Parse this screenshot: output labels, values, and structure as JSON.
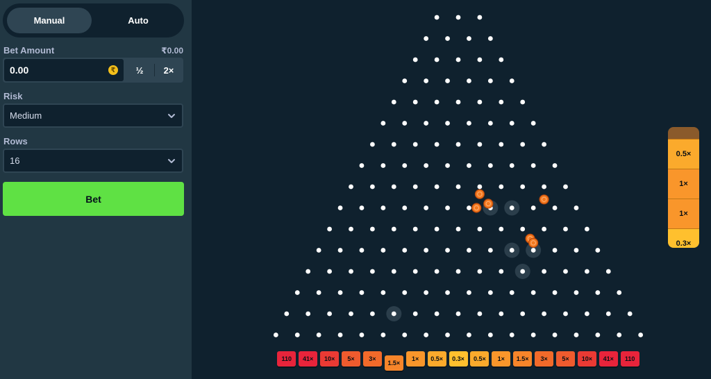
{
  "mode": {
    "manual_label": "Manual",
    "auto_label": "Auto",
    "active": "manual"
  },
  "bet": {
    "label": "Bet Amount",
    "balance": "₹0.00",
    "value": "0.00",
    "currency_symbol": "₹",
    "half_label": "½",
    "double_label": "2×"
  },
  "risk": {
    "label": "Risk",
    "value": "Medium"
  },
  "rows": {
    "label": "Rows",
    "value": "16"
  },
  "bet_button": {
    "label": "Bet"
  },
  "board": {
    "rows": 16,
    "slots": [
      {
        "label": "110",
        "color": "#e8243b"
      },
      {
        "label": "41×",
        "color": "#e8243b"
      },
      {
        "label": "10×",
        "color": "#ea3a34"
      },
      {
        "label": "5×",
        "color": "#ef5b2e"
      },
      {
        "label": "3×",
        "color": "#f26a2a"
      },
      {
        "label": "1.5×",
        "color": "#f7852a",
        "active": true
      },
      {
        "label": "1×",
        "color": "#f9962b"
      },
      {
        "label": "0.5×",
        "color": "#fbaa2c"
      },
      {
        "label": "0.3×",
        "color": "#ffc02e"
      },
      {
        "label": "0.5×",
        "color": "#fbaa2c"
      },
      {
        "label": "1×",
        "color": "#f9962b"
      },
      {
        "label": "1.5×",
        "color": "#f7852a"
      },
      {
        "label": "3×",
        "color": "#f26a2a"
      },
      {
        "label": "5×",
        "color": "#ef5b2e"
      },
      {
        "label": "10×",
        "color": "#ea3a34"
      },
      {
        "label": "41×",
        "color": "#e8243b"
      },
      {
        "label": "110",
        "color": "#e8243b"
      }
    ],
    "highlighted_pegs": [
      [
        7,
        10
      ],
      [
        9,
        7
      ],
      [
        9,
        8
      ],
      [
        11,
        9
      ],
      [
        11,
        10
      ],
      [
        12,
        10
      ],
      [
        14,
        5
      ]
    ],
    "balls": [
      {
        "row": 8.35,
        "offset": 6.0
      },
      {
        "row": 8.8,
        "offset": 6.4
      },
      {
        "row": 9.0,
        "offset": 6.35
      },
      {
        "row": 8.6,
        "offset": 9.0
      },
      {
        "row": 10.45,
        "offset": 9.35
      },
      {
        "row": 10.65,
        "offset": 9.5
      }
    ],
    "ball_color": "#f37a1f"
  },
  "history": [
    {
      "label": "",
      "color": "#8a5a2b"
    },
    {
      "label": "0.5×",
      "color": "#fbaa2c"
    },
    {
      "label": "1×",
      "color": "#f9962b"
    },
    {
      "label": "1×",
      "color": "#f9962b"
    },
    {
      "label": "0.3×",
      "color": "#ffc02e"
    }
  ]
}
